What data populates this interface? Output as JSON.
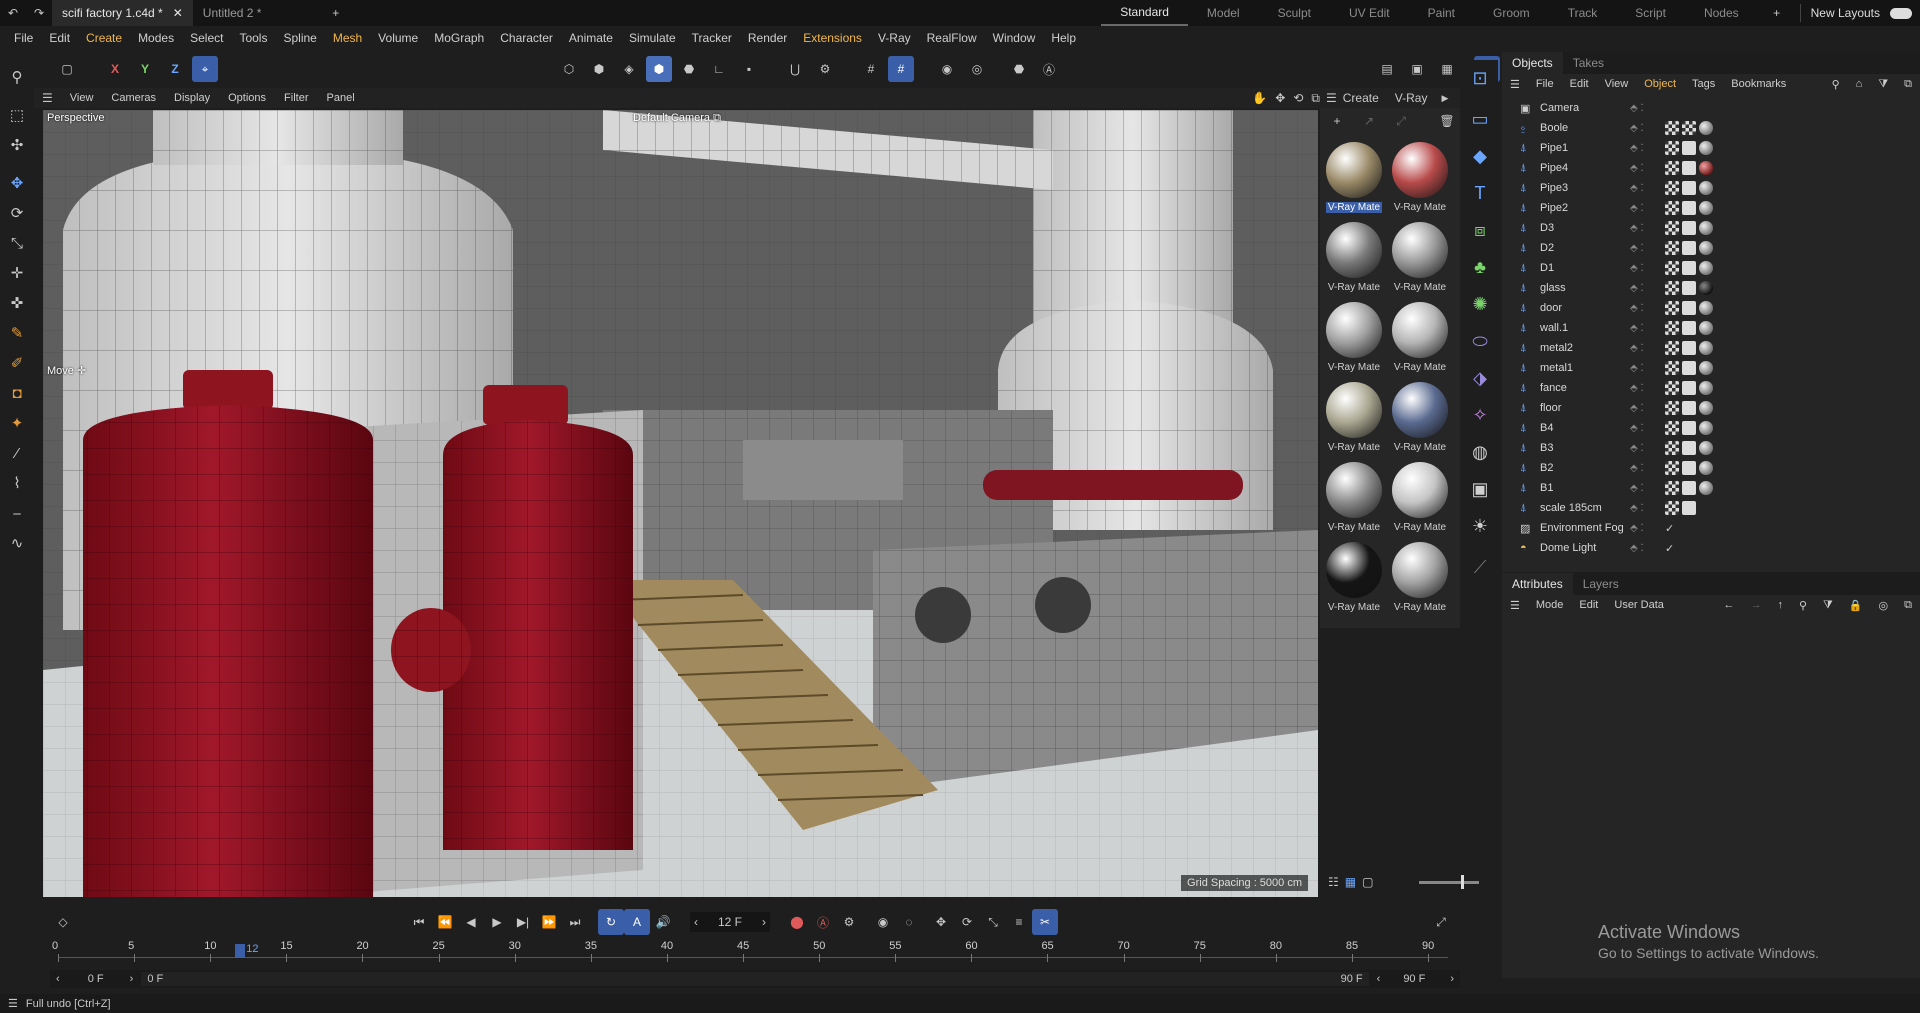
{
  "titlebar": {
    "tabs": [
      {
        "label": "scifi factory 1.c4d *",
        "active": true
      },
      {
        "label": "Untitled 2 *",
        "active": false
      }
    ],
    "layouts": [
      "Standard",
      "Model",
      "Sculpt",
      "UV Edit",
      "Paint",
      "Groom",
      "Track",
      "Script",
      "Nodes"
    ],
    "active_layout": "Standard",
    "new_layouts": "New Layouts"
  },
  "menubar": {
    "items": [
      "File",
      "Edit",
      "Create",
      "Modes",
      "Select",
      "Tools",
      "Spline",
      "Mesh",
      "Volume",
      "MoGraph",
      "Character",
      "Animate",
      "Simulate",
      "Tracker",
      "Render",
      "Extensions",
      "V-Ray",
      "RealFlow",
      "Window",
      "Help"
    ],
    "accent_items": [
      "Create",
      "Mesh",
      "Extensions"
    ]
  },
  "toolbar": {
    "axes": [
      "X",
      "Y",
      "Z"
    ]
  },
  "viewport": {
    "menu": [
      "View",
      "Cameras",
      "Display",
      "Options",
      "Filter",
      "Panel"
    ],
    "label": "Perspective",
    "camera": "Default Camera",
    "tool_label": "Move",
    "grid_spacing": "Grid Spacing : 5000 cm"
  },
  "materials": {
    "menu": [
      "Create",
      "V-Ray"
    ],
    "items": [
      {
        "label": "V-Ray Mate",
        "color": "#9a8a68",
        "selected": true
      },
      {
        "label": "V-Ray Mate",
        "color": "#b84a4a",
        "selected": false
      },
      {
        "label": "V-Ray Mate",
        "color": "#7a7a7a",
        "selected": false
      },
      {
        "label": "V-Ray Mate",
        "color": "#9a9a9a",
        "selected": false
      },
      {
        "label": "V-Ray Mate",
        "color": "#a0a0a0",
        "selected": false
      },
      {
        "label": "V-Ray Mate",
        "color": "#b5b5b5",
        "selected": false
      },
      {
        "label": "V-Ray Mate",
        "color": "#a9a690",
        "selected": false
      },
      {
        "label": "V-Ray Mate",
        "color": "#5a6a90",
        "selected": false
      },
      {
        "label": "V-Ray Mate",
        "color": "#8a8a8a",
        "selected": false
      },
      {
        "label": "V-Ray Mate",
        "color": "#c4c4c4",
        "selected": false
      },
      {
        "label": "V-Ray Mate",
        "color": "#151515",
        "selected": false
      },
      {
        "label": "V-Ray Mate",
        "color": "#a3a3a3",
        "selected": false
      }
    ]
  },
  "objects_panel": {
    "tabs": [
      "Objects",
      "Takes"
    ],
    "menu": [
      "File",
      "Edit",
      "View",
      "Object",
      "Tags",
      "Bookmarks"
    ],
    "accent_menu": "Object",
    "rows": [
      {
        "name": "Camera",
        "icon": "camera-icon",
        "tags": []
      },
      {
        "name": "Boole",
        "icon": "boole-icon",
        "tags": [
          "chk",
          "chk",
          "ball"
        ]
      },
      {
        "name": "Pipe1",
        "icon": "null-icon",
        "tags": [
          "chk",
          "ph",
          "ball"
        ]
      },
      {
        "name": "Pipe4",
        "icon": "null-icon",
        "tags": [
          "chk",
          "ph",
          "ballr"
        ]
      },
      {
        "name": "Pipe3",
        "icon": "null-icon",
        "tags": [
          "chk",
          "ph",
          "ball"
        ]
      },
      {
        "name": "Pipe2",
        "icon": "null-icon",
        "tags": [
          "chk",
          "ph",
          "ball"
        ]
      },
      {
        "name": "D3",
        "icon": "null-icon",
        "tags": [
          "chk",
          "ph",
          "ball"
        ]
      },
      {
        "name": "D2",
        "icon": "null-icon",
        "tags": [
          "chk",
          "ph",
          "ball"
        ]
      },
      {
        "name": "D1",
        "icon": "null-icon",
        "tags": [
          "chk",
          "ph",
          "ball"
        ]
      },
      {
        "name": "glass",
        "icon": "null-icon",
        "tags": [
          "chk",
          "ph",
          "ballk"
        ]
      },
      {
        "name": "door",
        "icon": "null-icon",
        "tags": [
          "chk",
          "ph",
          "ball"
        ]
      },
      {
        "name": "wall.1",
        "icon": "null-icon",
        "tags": [
          "chk",
          "ph",
          "ball"
        ]
      },
      {
        "name": "metal2",
        "icon": "null-icon",
        "tags": [
          "chk",
          "ph",
          "ball"
        ]
      },
      {
        "name": "metal1",
        "icon": "null-icon",
        "tags": [
          "chk",
          "ph",
          "ball"
        ]
      },
      {
        "name": "fance",
        "icon": "null-icon",
        "tags": [
          "chk",
          "ph",
          "ball"
        ]
      },
      {
        "name": "floor",
        "icon": "null-icon",
        "tags": [
          "chk",
          "ph",
          "ball"
        ]
      },
      {
        "name": "B4",
        "icon": "null-icon",
        "tags": [
          "chk",
          "ph",
          "ball"
        ]
      },
      {
        "name": "B3",
        "icon": "null-icon",
        "tags": [
          "chk",
          "ph",
          "ball"
        ]
      },
      {
        "name": "B2",
        "icon": "null-icon",
        "tags": [
          "chk",
          "ph",
          "ball"
        ]
      },
      {
        "name": "B1",
        "icon": "null-icon",
        "tags": [
          "chk",
          "ph",
          "ball"
        ]
      },
      {
        "name": "scale 185cm",
        "icon": "null-icon",
        "tags": [
          "chk",
          "ph"
        ]
      },
      {
        "name": "Environment Fog",
        "icon": "fog-icon",
        "tags": []
      },
      {
        "name": "Dome Light",
        "icon": "light-icon",
        "tags": []
      }
    ]
  },
  "attributes_panel": {
    "tabs": [
      "Attributes",
      "Layers"
    ],
    "menu": [
      "Mode",
      "Edit",
      "User Data"
    ]
  },
  "timeline": {
    "current_frame": "12 F",
    "ticks": [
      "0",
      "5",
      "10",
      "15",
      "20",
      "25",
      "30",
      "35",
      "40",
      "45",
      "50",
      "55",
      "60",
      "65",
      "70",
      "75",
      "80",
      "85",
      "90"
    ],
    "playhead_label": "12",
    "playhead_fraction": 0.133,
    "start_frame": "0 F",
    "range_start": "0 F",
    "range_end": "90 F",
    "end_frame": "90 F",
    "end_frame_b": "90 F"
  },
  "status": {
    "message": "Full undo [Ctrl+Z]"
  },
  "watermark": {
    "title": "Activate Windows",
    "subtitle": "Go to Settings to activate Windows."
  },
  "colors": {
    "accent": "#f2b84b",
    "select_blue": "#3a5ea8",
    "tank_red": "#8e1420"
  }
}
